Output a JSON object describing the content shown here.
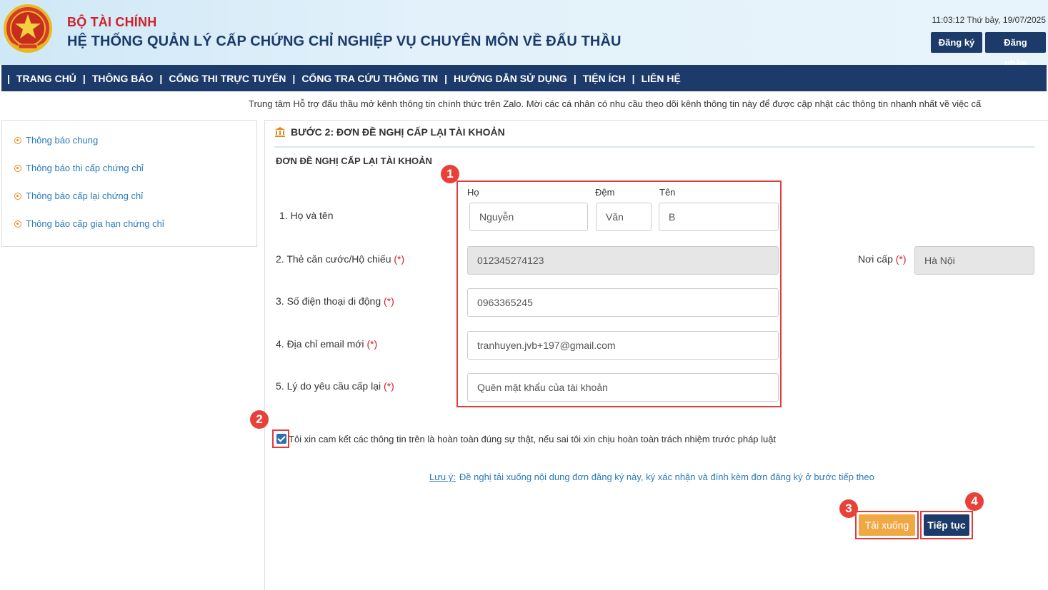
{
  "header": {
    "ministry": "BỘ TÀI CHÍNH",
    "system_title": "HỆ THỐNG QUẢN LÝ CẤP CHỨNG CHỈ NGHIỆP VỤ CHUYÊN MÔN VỀ ĐẤU THẦU",
    "clock": "11:03:12 Thứ bảy, 19/07/2025",
    "register_label": "Đăng ký",
    "login_label": "Đăng nhập"
  },
  "nav": {
    "items": [
      "TRANG CHỦ",
      "THÔNG BÁO",
      "CỔNG THI TRỰC TUYẾN",
      "CỔNG TRA CỨU THÔNG TIN",
      "HƯỚNG DẪN SỬ DỤNG",
      "TIỆN ÍCH",
      "LIÊN HỆ"
    ],
    "separator": "|"
  },
  "marquee": "Trung tâm Hỗ trợ đấu thầu mở kênh thông tin chính thức trên Zalo. Mời các cá nhân có nhu cầu theo dõi kênh thông tin này để được cập nhật các thông tin nhanh nhất về việc cấ",
  "sidebar": {
    "items": [
      "Thông báo chung",
      "Thông báo thi cấp chứng chỉ",
      "Thông báo cấp lại chứng chỉ",
      "Thông báo cấp gia hạn chứng chỉ"
    ]
  },
  "form": {
    "step_title": "BƯỚC 2: ĐƠN ĐỀ NGHỊ CẤP LẠI TÀI KHOẢN",
    "title": "ĐƠN ĐỀ NGHỊ CẤP LẠI TÀI KHOẢN",
    "required_mark": "(*)",
    "name": {
      "label": "1. Họ và tên",
      "last_label": "Họ",
      "middle_label": "Đệm",
      "first_label": "Tên",
      "last_value": "Nguyễn",
      "middle_value": "Văn",
      "first_value": "B"
    },
    "id_card": {
      "label": "2. Thẻ căn cước/Hộ chiếu",
      "value": "012345274123"
    },
    "issue_place": {
      "label": "Nơi cấp",
      "value": "Hà Nội"
    },
    "phone": {
      "label": "3. Số điện thoại di động",
      "value": "0963365245"
    },
    "email": {
      "label": "4. Địa chỉ email mới",
      "value": "tranhuyen.jvb+197@gmail.com"
    },
    "reason": {
      "label": "5. Lý do yêu cầu cấp lại",
      "value": "Quên mật khẩu của tài khoản"
    },
    "commitment": "Tôi xin cam kết các thông tin trên là hoàn toàn đúng sự thật, nếu sai tôi xin chịu hoàn toàn trách nhiệm trước pháp luật",
    "commitment_checked": true,
    "note_label": "Lưu ý:",
    "note_text": "Đề nghị tải xuống nội dung đơn đăng ký này, ký xác nhận và đính kèm đơn đăng ký ở bước tiếp theo",
    "download_label": "Tải xuống",
    "continue_label": "Tiếp tục"
  },
  "annotations": [
    "1",
    "2",
    "3",
    "4"
  ],
  "colors": {
    "navy": "#1d3b6a",
    "brand_red": "#d0202b",
    "link_blue": "#2a7bb8",
    "download_orange": "#f0a843",
    "annotation_red": "#e03c3c"
  }
}
